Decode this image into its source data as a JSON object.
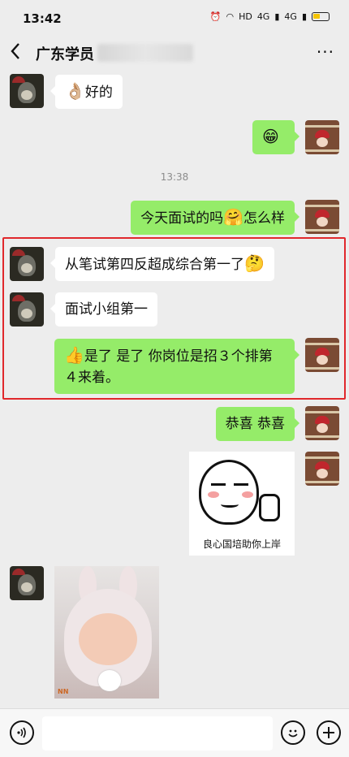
{
  "status_bar": {
    "time": "13:42",
    "network_labels": [
      "HD",
      "4G",
      "4G"
    ]
  },
  "header": {
    "title": "广东学员",
    "more": "···"
  },
  "messages": [
    {
      "side": "left",
      "emoji": "👌🏼",
      "text": "好的"
    },
    {
      "side": "right",
      "emoji": "😁",
      "text": ""
    },
    {
      "side": "right",
      "text_before": "今天面试的吗",
      "emoji": "🤗",
      "text_after": "怎么样"
    },
    {
      "side": "left",
      "text": "从笔试第四反超成综合第一了",
      "emoji": "🤔"
    },
    {
      "side": "left",
      "text": "面试小组第一"
    },
    {
      "side": "right",
      "emoji": "👍",
      "line1": "是了 是了 你岗位是招３个排第",
      "line2": "４来着。"
    },
    {
      "side": "right",
      "text": "恭喜 恭喜"
    },
    {
      "side": "right",
      "type": "sticker",
      "caption": "良心国培助你上岸"
    },
    {
      "side": "left",
      "type": "photo",
      "watermark": "NN"
    }
  ],
  "timestamp": "13:38",
  "input": {
    "placeholder": ""
  },
  "colors": {
    "green_bubble": "#95ec69",
    "highlight": "#e0282c",
    "background": "#ededed"
  }
}
